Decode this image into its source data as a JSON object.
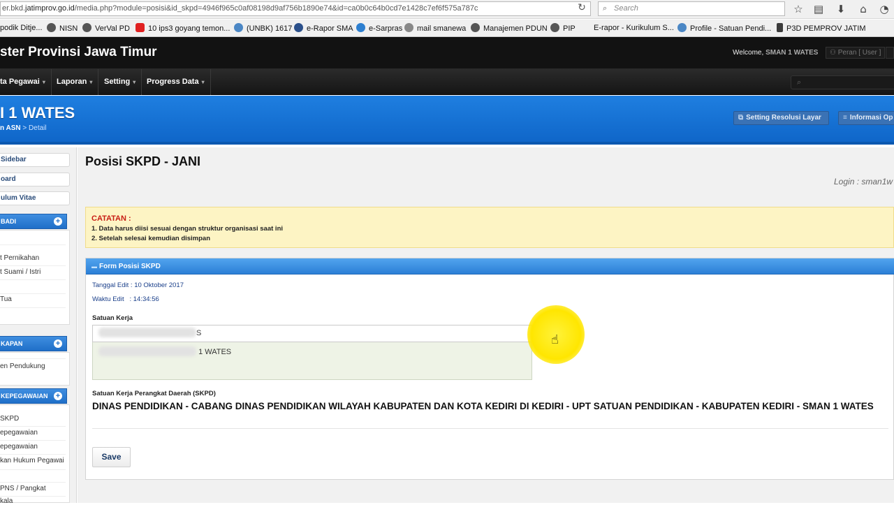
{
  "browser": {
    "url_prefix": "er.bkd.",
    "url_host": "jatimprov.go.id",
    "url_path": "/media.php?module=posisi&id_skpd=4946f965c0af08198d9af756b1890e74&id=ca0b0c64b0cd7e1428c7ef6f575a787c",
    "search_placeholder": "Search",
    "bookmarks": [
      "podik Ditje...",
      "NISN",
      "VerVal PD",
      "10 ips3 goyang temon...",
      "(UNBK) 1617",
      "e-Rapor SMA",
      "e-Sarpras",
      "mail smanewa",
      "Manajemen PDUN",
      "PIP",
      "E-rapor - Kurikulum S...",
      "Profile - Satuan Pendi...",
      "P3D PEMPROV JATIM"
    ]
  },
  "header": {
    "app_title": "ster Provinsi Jawa Timur",
    "welcome_label": "Welcome,",
    "welcome_user": "SMAN 1 WATES",
    "peran_label": "Peran [ User ]"
  },
  "nav": {
    "items": [
      "ta Pegawai",
      "Laporan",
      "Setting",
      "Progress Data"
    ]
  },
  "banner": {
    "school_name": "I 1 WATES",
    "crumb_current": "n ASN",
    "crumb_sep": ">",
    "crumb_detail": "Detail",
    "btn_resolusi": "Setting Resolusi Layar",
    "btn_informasi": "Informasi Op"
  },
  "sidebar": {
    "buttons": [
      "Sidebar",
      "oard",
      "ulum Vitae"
    ],
    "sections": [
      {
        "title": "BADI",
        "items": [
          "t Pernikahan",
          "t Suami / Istri",
          "Tua"
        ]
      },
      {
        "title": "KAPAN",
        "items": [
          "en Pendukung"
        ]
      },
      {
        "title": "KEPEGAWAIAN",
        "items": [
          "SKPD",
          "epegawaian",
          "epegawaian",
          "kan Hukum Pegawai",
          "PNS / Pangkat",
          "kala"
        ]
      }
    ]
  },
  "main": {
    "page_title": "Posisi SKPD - JANI",
    "login_text": "Login : sman1w",
    "note": {
      "title": "CATATAN :",
      "lines": [
        "1. Data harus diisi sesuai dengan struktur organisasi saat ini",
        "2. Setelah selesai kemudian disimpan"
      ]
    },
    "form": {
      "title": "Form Posisi SKPD",
      "tanggal_edit": "Tanggal Edit : 10 Oktober 2017",
      "waktu_edit": "Waktu Edit   : 14:34:56",
      "satuan_kerja_label": "Satuan Kerja",
      "satuan_kerja_value_visible": "S",
      "select_button": "select",
      "dropdown_option_visible": "1 WATES",
      "skpd_label": "Satuan Kerja Perangkat Daerah (SKPD)",
      "skpd_value": "DINAS PENDIDIKAN - CABANG DINAS PENDIDIKAN WILAYAH KABUPATEN DAN KOTA KEDIRI DI KEDIRI - UPT SATUAN PENDIDIKAN - KABUPATEN KEDIRI - SMAN 1 WATES",
      "save_label": "Save"
    }
  },
  "colors": {
    "banner_blue": "#1672d6",
    "header_black": "#121212",
    "note_bg": "#fdf4c4",
    "note_title": "#c81d14",
    "highlight_yellow": "#ffe600"
  }
}
